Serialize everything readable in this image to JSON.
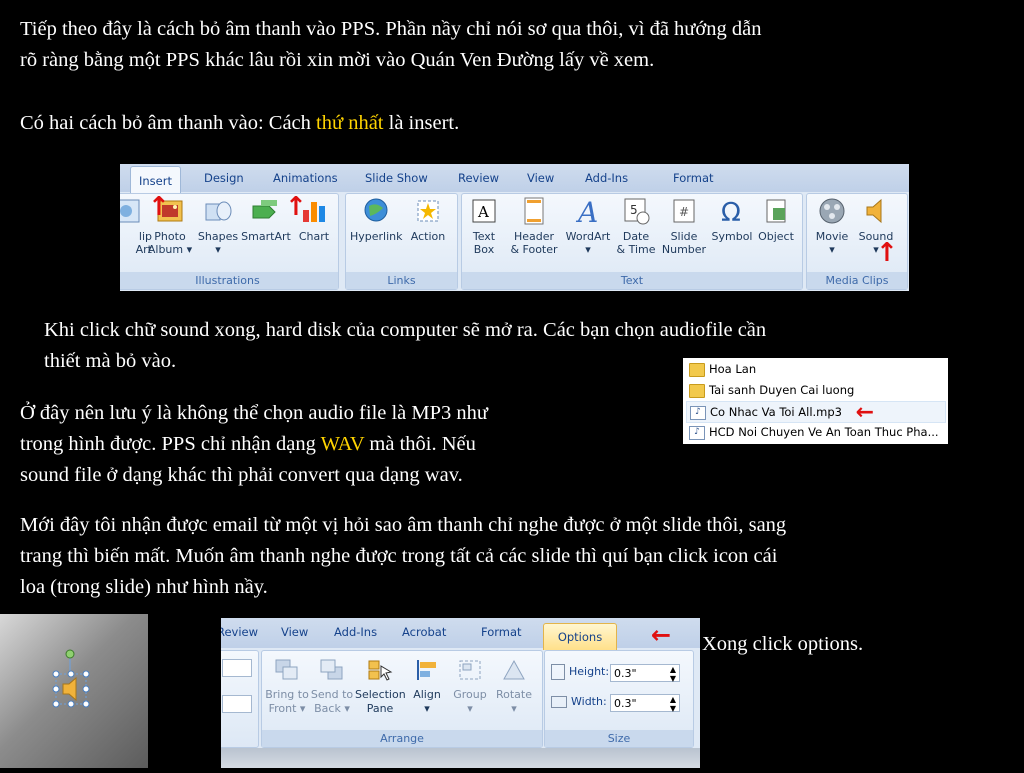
{
  "intro": {
    "line1": "Tiếp theo đây là cách bỏ âm thanh vào PPS. Phần nầy chỉ nói sơ qua thôi, vì đã hướng dẫn",
    "line2": "rõ ràng bằng một PPS khác lâu rồi xin mời vào Quán Ven Đường lấy về xem."
  },
  "method": {
    "before": "Có hai cách bỏ âm thanh vào: Cách ",
    "highlight": "thứ nhất",
    "after": " là insert."
  },
  "ribbon1": {
    "tabs": [
      "Insert",
      "Design",
      "Animations",
      "Slide Show",
      "Review",
      "View",
      "Add-Ins",
      "Format"
    ],
    "groups": {
      "illustrations": "Illustrations",
      "links": "Links",
      "text": "Text",
      "media": "Media Clips"
    },
    "buttons": {
      "clipart_l1": "lip",
      "clipart_l2": "Art",
      "photo_l1": "Photo",
      "photo_l2": "Album ▾",
      "shapes_l1": "Shapes",
      "shapes_l2": "▾",
      "smartart": "SmartArt",
      "chart": "Chart",
      "hyperlink": "Hyperlink",
      "action": "Action",
      "textbox_l1": "Text",
      "textbox_l2": "Box",
      "header_l1": "Header",
      "header_l2": "& Footer",
      "wordart_l1": "WordArt",
      "wordart_l2": "▾",
      "date_l1": "Date",
      "date_l2": "& Time",
      "slidenum_l1": "Slide",
      "slidenum_l2": "Number",
      "symbol": "Symbol",
      "object": "Object",
      "movie_l1": "Movie",
      "movie_l2": "▾",
      "sound_l1": "Sound",
      "sound_l2": "▾"
    }
  },
  "sound_click": {
    "line1": "Khi click chữ sound xong, hard disk của computer sẽ mở ra. Các bạn chọn audiofile cần",
    "line2": "thiết mà bỏ vào."
  },
  "file_list": [
    "Hoa Lan",
    "Tai sanh Duyen Cai luong",
    "Co Nhac Va Toi All.mp3",
    "HCD Noi Chuyen Ve An Toan Thuc Pha..."
  ],
  "note": {
    "line1": "Ở đây nên lưu ý là không thể chọn audio file là MP3 như",
    "line2_before": "trong hình được. PPS chỉ nhận dạng ",
    "line2_hl": "WAV",
    "line2_after": " mà thôi. Nếu",
    "line3": "sound file ở dạng khác thì phải convert qua dạng wav."
  },
  "email": {
    "line1": "Mới đây tôi nhận được email từ một vị hỏi sao âm thanh chỉ nghe được ở một slide thôi, sang",
    "line2": "trang thì biến mất. Muốn âm thanh nghe được trong tất cả các slide thì quí bạn click icon cái",
    "line3": "loa (trong slide) như hình nầy."
  },
  "ribbon2": {
    "tabs": [
      "Review",
      "View",
      "Add-Ins",
      "Acrobat",
      "Format",
      "Options"
    ],
    "buttons": {
      "bringfront_l1": "Bring to",
      "bringfront_l2": "Front ▾",
      "sendback_l1": "Send to",
      "sendback_l2": "Back ▾",
      "selection_l1": "Selection",
      "selection_l2": "Pane",
      "align_l1": "Align",
      "align_l2": "▾",
      "group_l1": "Group",
      "group_l2": "▾",
      "rotate_l1": "Rotate",
      "rotate_l2": "▾"
    },
    "arrange_label": "Arrange",
    "size_label": "Size",
    "height_label": "Height:",
    "height_value": "0.3\"",
    "width_label": "Width:",
    "width_value": "0.3\""
  },
  "options_caption": "Xong click options.",
  "arrow_glyph_up": "↑",
  "arrow_glyph_left": "←"
}
